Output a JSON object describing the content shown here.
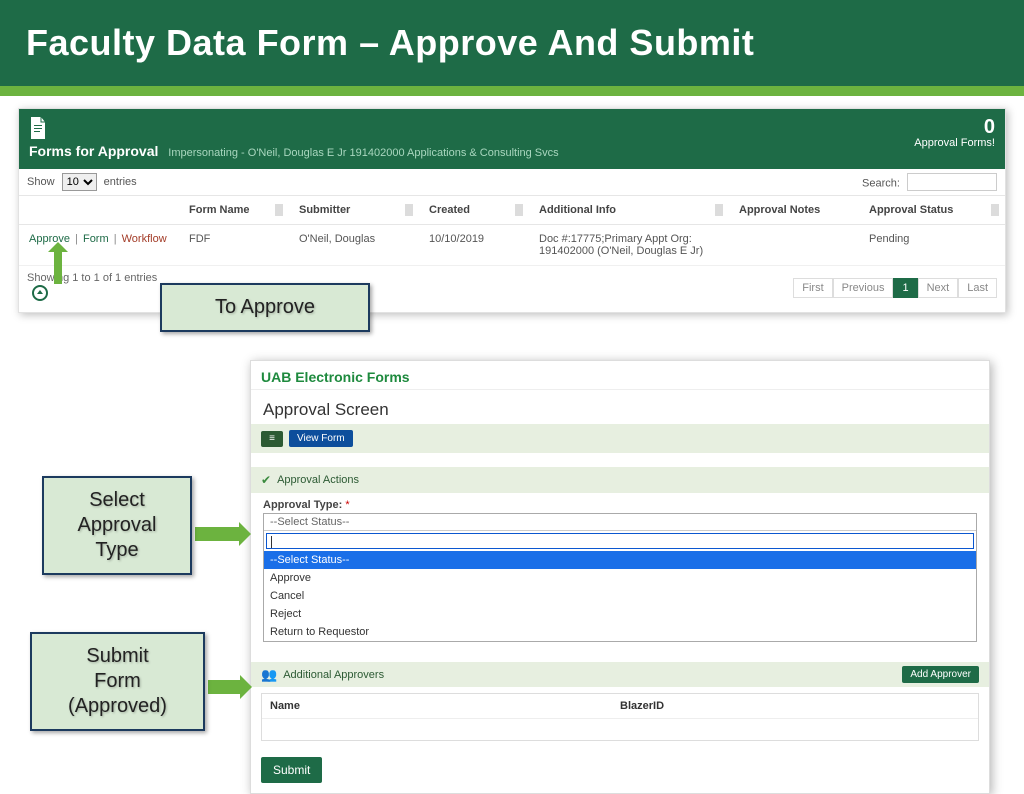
{
  "slide_title": "Faculty Data Form – Approve And Submit",
  "panel1": {
    "title": "Forms for Approval",
    "impersonating": "Impersonating - O'Neil, Douglas E Jr 191402000 Applications & Consulting Svcs",
    "count_num": "0",
    "count_label": "Approval Forms!",
    "show_label_pre": "Show",
    "show_value": "10",
    "show_label_post": "entries",
    "search_label": "Search:",
    "columns": {
      "actions": "",
      "form_name": "Form Name",
      "submitter": "Submitter",
      "created": "Created",
      "additional_info": "Additional Info",
      "approval_notes": "Approval Notes",
      "approval_status": "Approval Status"
    },
    "row": {
      "actions": {
        "approve": "Approve",
        "form": "Form",
        "workflow": "Workflow"
      },
      "form_name": "FDF",
      "submitter": "O'Neil, Douglas",
      "created": "10/10/2019",
      "additional_info": "Doc #:17775;Primary Appt Org: 191402000 (O'Neil, Douglas E Jr)",
      "approval_notes": "",
      "approval_status": "Pending"
    },
    "showing": "Showing 1 to 1 of 1 entries",
    "pager": {
      "first": "First",
      "previous": "Previous",
      "page": "1",
      "next": "Next",
      "last": "Last"
    }
  },
  "callouts": {
    "to_approve": "To Approve",
    "select_type_l1": "Select",
    "select_type_l2": "Approval",
    "select_type_l3": "Type",
    "submit_l1": "Submit",
    "submit_l2": "Form",
    "submit_l3": "(Approved)"
  },
  "panel2": {
    "brand": "UAB Electronic Forms",
    "section": "Approval Screen",
    "view_form": "View Form",
    "approval_actions": "Approval Actions",
    "approval_type_label": "Approval Type:",
    "required_mark": "*",
    "select_placeholder": "--Select Status--",
    "options": {
      "select_status": "--Select Status--",
      "approve": "Approve",
      "cancel": "Cancel",
      "reject": "Reject",
      "return": "Return to Requestor"
    },
    "additional_approvers": "Additional Approvers",
    "add_approver": "Add Approver",
    "grid_name": "Name",
    "grid_blazer": "BlazerID",
    "submit": "Submit"
  }
}
